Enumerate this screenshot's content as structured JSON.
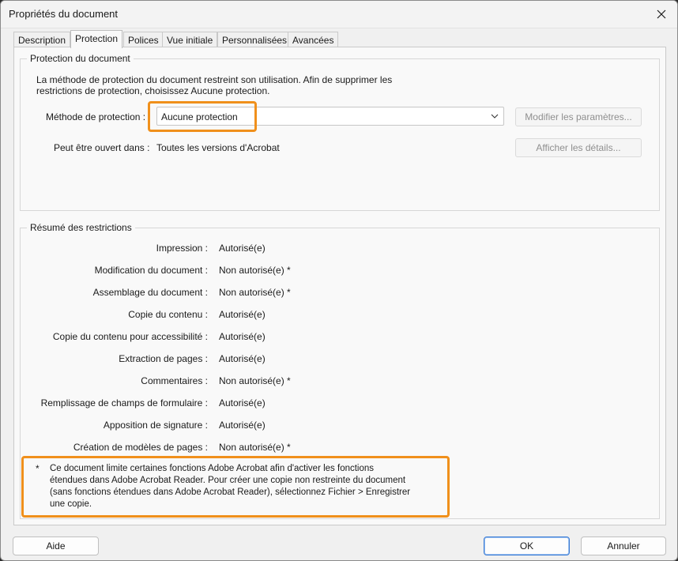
{
  "window": {
    "title": "Propriétés du document"
  },
  "tabs": [
    {
      "label": "Description"
    },
    {
      "label": "Protection"
    },
    {
      "label": "Polices"
    },
    {
      "label": "Vue initiale"
    },
    {
      "label": "Personnalisées"
    },
    {
      "label": "Avancées"
    }
  ],
  "active_tab": "Protection",
  "protection": {
    "legend": "Protection du document",
    "desc_line1": "La méthode de protection du document restreint son utilisation. Afin de supprimer les",
    "desc_line2": "restrictions de protection, choisissez Aucune protection.",
    "method_label": "Méthode de protection :",
    "method_value": "Aucune protection",
    "modify_button": "Modifier les paramètres...",
    "open_label": "Peut être ouvert dans :",
    "open_value": "Toutes les versions d'Acrobat",
    "details_button": "Afficher les détails..."
  },
  "restrictions": {
    "legend": "Résumé des restrictions",
    "rows": [
      {
        "label": "Impression :",
        "value": "Autorisé(e)"
      },
      {
        "label": "Modification du document :",
        "value": "Non autorisé(e) *"
      },
      {
        "label": "Assemblage du document :",
        "value": "Non autorisé(e) *"
      },
      {
        "label": "Copie du contenu :",
        "value": "Autorisé(e)"
      },
      {
        "label": "Copie du contenu pour accessibilité :",
        "value": "Autorisé(e)"
      },
      {
        "label": "Extraction de pages :",
        "value": "Autorisé(e)"
      },
      {
        "label": "Commentaires :",
        "value": "Non autorisé(e) *"
      },
      {
        "label": "Remplissage de champs de formulaire :",
        "value": "Autorisé(e)"
      },
      {
        "label": "Apposition de signature :",
        "value": "Autorisé(e)"
      },
      {
        "label": "Création de modèles de pages :",
        "value": "Non autorisé(e) *"
      }
    ],
    "note_marker": "*",
    "note_lines": [
      "Ce document limite certaines fonctions Adobe Acrobat afin d'activer les fonctions",
      "étendues dans Adobe Acrobat Reader. Pour créer une copie non restreinte du document",
      "(sans fonctions étendues dans Adobe Acrobat Reader), sélectionnez Fichier > Enregistrer",
      "une copie."
    ]
  },
  "footer": {
    "help": "Aide",
    "ok": "OK",
    "cancel": "Annuler"
  },
  "colors": {
    "highlight": "#f0901c",
    "primary_border": "#3a7bd5"
  }
}
